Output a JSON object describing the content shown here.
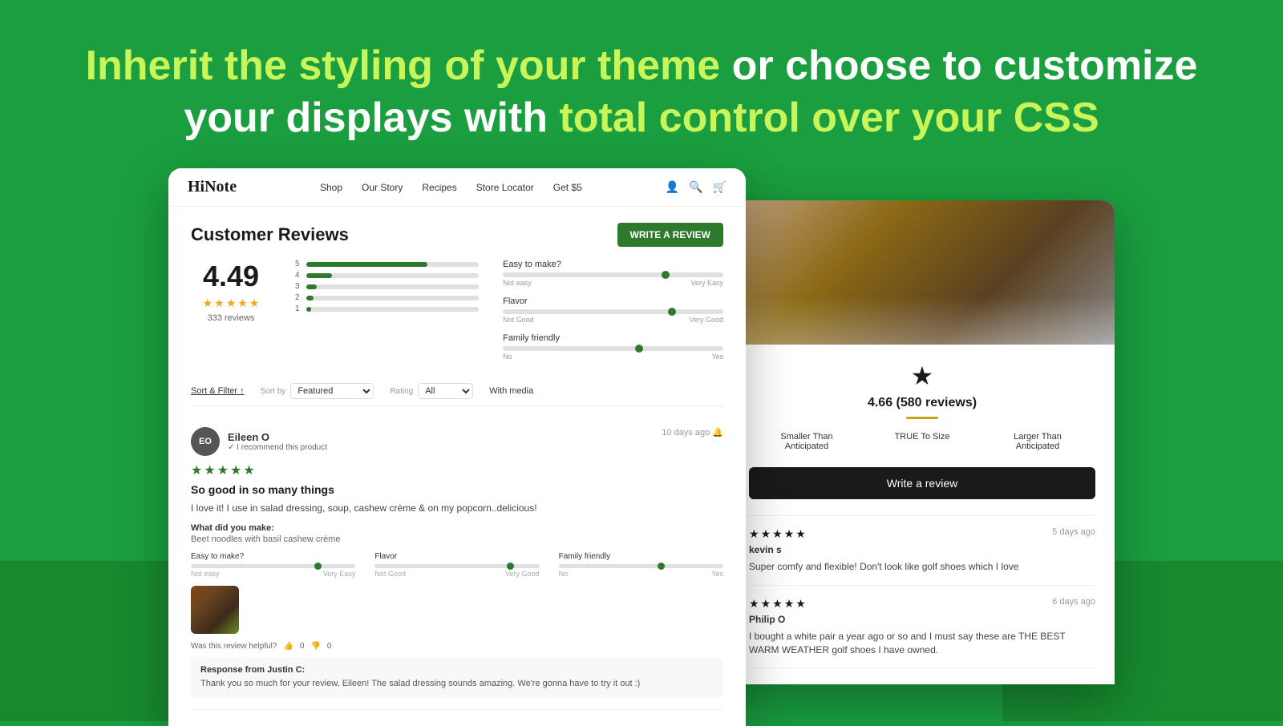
{
  "page": {
    "background_color": "#1a9e3f"
  },
  "hero": {
    "line1_part1": "Inherit the styling of your theme",
    "line1_part2": "or choose to customize",
    "line2_part1": "your displays with",
    "line2_part2": "total control over your CSS"
  },
  "left_screenshot": {
    "nav": {
      "logo": "HiNote",
      "links": [
        "Shop",
        "Our Story",
        "Recipes",
        "Store Locator",
        "Get $5"
      ]
    },
    "reviews_title": "Customer Reviews",
    "write_review_btn": "WRITE A REVIEW",
    "overall_score": "4.49",
    "review_count": "333 reviews",
    "bars": [
      {
        "label": "5",
        "width": "70%"
      },
      {
        "label": "4",
        "width": "15%"
      },
      {
        "label": "3",
        "width": "5%"
      },
      {
        "label": "2",
        "width": "4%"
      },
      {
        "label": "1",
        "width": "3%"
      }
    ],
    "attributes": [
      {
        "name": "Easy to make?",
        "left": "Not easy",
        "right": "Very Easy",
        "position": "72%"
      },
      {
        "name": "Flavor",
        "left": "Not Good",
        "right": "Very Good",
        "position": "75%"
      },
      {
        "name": "Family friendly",
        "left": "No",
        "right": "Yes",
        "position": "60%"
      }
    ],
    "sort_filter": {
      "label": "Sort & Filter",
      "sort_by_label": "Sort by",
      "sort_by_value": "Featured",
      "rating_label": "Rating",
      "rating_value": "All",
      "with_media": "With media"
    },
    "review": {
      "initials": "EO",
      "name": "Eileen O",
      "recommend": "I recommend this product",
      "date": "10 days ago",
      "stars": 5,
      "title": "So good in so many things",
      "body": "I love it! I use in salad dressing, soup, cashew crème & on my popcorn..delicious!",
      "made_label": "What did you make:",
      "made_value": "Beet noodles with basil cashew crème",
      "attr1_name": "Easy to make?",
      "attr1_left": "Not easy",
      "attr1_right": "Very Easy",
      "attr1_pos": "75%",
      "attr2_name": "Flavor",
      "attr2_left": "Not Good",
      "attr2_right": "Very Good",
      "attr2_pos": "80%",
      "attr3_name": "Family friendly",
      "attr3_left": "No",
      "attr3_right": "Yes",
      "attr3_pos": "60%",
      "helpful_text": "Was this review helpful?",
      "helpful_yes": "0",
      "helpful_no": "0",
      "response_from": "Response from Justin C:",
      "response_text": "Thank you so much for your review, Eileen! The salad dressing sounds amazing. We're gonna have to try it out :)"
    }
  },
  "right_screenshot": {
    "score": "4.66 (580 reviews)",
    "separator_color": "#c8a020",
    "size_fit": [
      {
        "label": "Smaller Than\nAnticipated"
      },
      {
        "label": "TRUE To Size"
      },
      {
        "label": "Larger Than\nAnticipated"
      }
    ],
    "write_review_btn": "Write a review",
    "reviews": [
      {
        "stars": 5,
        "date": "5 days ago",
        "reviewer": "kevin s",
        "text": "Super comfy and flexible! Don't look like golf shoes which I love"
      },
      {
        "stars": 5,
        "date": "6 days ago",
        "reviewer": "Philip O",
        "text": "I bought a white pair a year ago or so and I must say these are THE BEST WARM WEATHER golf shoes I have owned."
      }
    ]
  }
}
